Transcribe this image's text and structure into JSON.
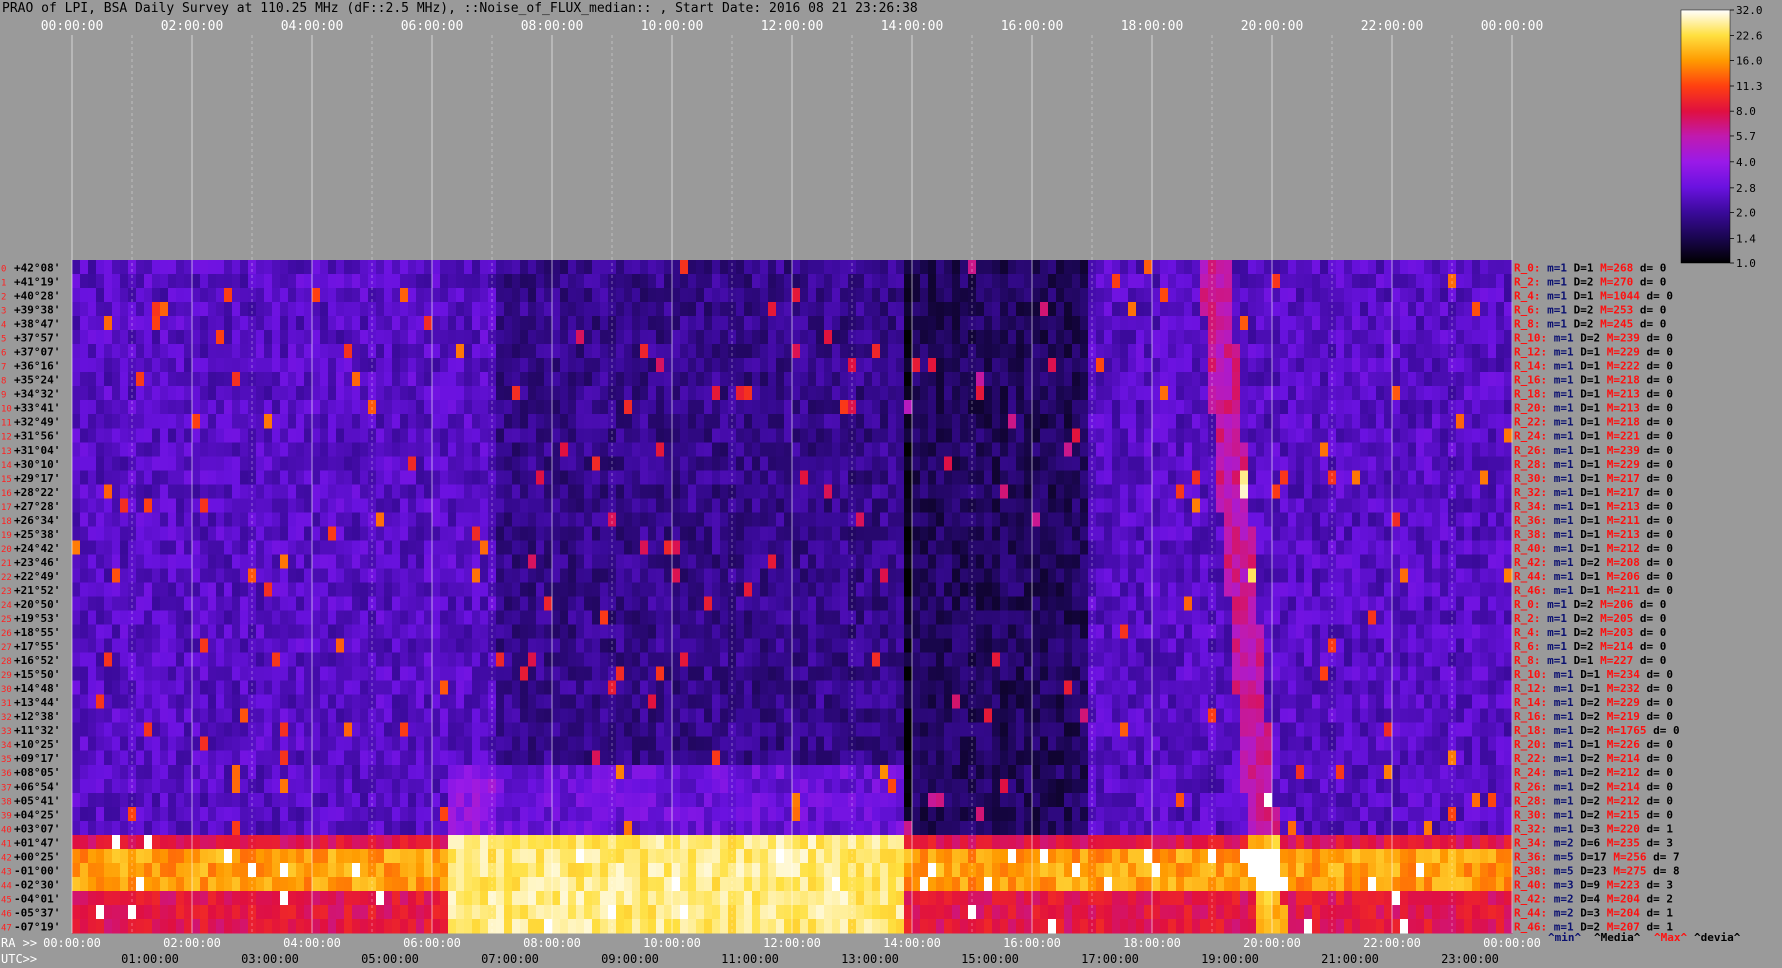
{
  "header": {
    "title": "PRAO of LPI, BSA Daily Survey at 110.25 MHz (dF::2.5 MHz), ::Noise_of_FLUX_median:: , Start Date: 2016 08 21 23:26:38"
  },
  "chart_data": {
    "type": "heatmap",
    "title": "PRAO of LPI, BSA Daily Survey at 110.25 MHz (dF::2.5 MHz), ::Noise_of_FLUX_median:: , Start Date: 2016 08 21 23:26:38",
    "x_top_ticks": [
      "00:00:00",
      "02:00:00",
      "04:00:00",
      "06:00:00",
      "08:00:00",
      "10:00:00",
      "12:00:00",
      "14:00:00",
      "16:00:00",
      "18:00:00",
      "20:00:00",
      "22:00:00",
      "00:00:00"
    ],
    "x_bottom_ra_ticks": [
      "00:00:00",
      "02:00:00",
      "04:00:00",
      "06:00:00",
      "08:00:00",
      "10:00:00",
      "12:00:00",
      "14:00:00",
      "16:00:00",
      "18:00:00",
      "20:00:00",
      "22:00:00",
      "00:00:00"
    ],
    "x_bottom_utc_ticks": [
      "01:00:00",
      "03:00:00",
      "05:00:00",
      "07:00:00",
      "09:00:00",
      "11:00:00",
      "13:00:00",
      "15:00:00",
      "17:00:00",
      "19:00:00",
      "21:00:00",
      "23:00:00"
    ],
    "ra_label": "RA >>",
    "utc_label": "UTC>>",
    "declinations": [
      "+42°08'",
      "+41°19'",
      "+40°28'",
      "+39°38'",
      "+38°47'",
      "+37°57'",
      "+37°07'",
      "+36°16'",
      "+35°24'",
      "+34°32'",
      "+33°41'",
      "+32°49'",
      "+31°56'",
      "+31°04'",
      "+30°10'",
      "+29°17'",
      "+28°22'",
      "+27°28'",
      "+26°34'",
      "+25°38'",
      "+24°42'",
      "+23°46'",
      "+22°49'",
      "+21°52'",
      "+20°50'",
      "+19°53'",
      "+18°55'",
      "+17°55'",
      "+16°52'",
      "+15°50'",
      "+14°48'",
      "+13°44'",
      "+12°38'",
      "+11°32'",
      "+10°25'",
      "+09°17'",
      "+08°05'",
      "+06°54'",
      "+05°41'",
      "+04°25'",
      "+03°07'",
      "+01°47'",
      "+00°25'",
      "-01°00'",
      "-02°30'",
      "-04°01'",
      "-05°37'",
      "-07°19'"
    ],
    "row_indices": [
      "0",
      "1",
      "2",
      "3",
      "4",
      "5",
      "6",
      "7",
      "8",
      "9",
      "10",
      "11",
      "12",
      "13",
      "14",
      "15",
      "16",
      "17",
      "18",
      "19",
      "20",
      "21",
      "22",
      "23",
      "24",
      "25",
      "26",
      "27",
      "28",
      "29",
      "30",
      "31",
      "32",
      "33",
      "34",
      "35",
      "36",
      "37",
      "38",
      "39",
      "40",
      "41",
      "42",
      "43",
      "44",
      "45",
      "46",
      "47"
    ],
    "stats": [
      {
        "r": "R_0:",
        "m": "m=1",
        "D": "D=1",
        "M": "M=268",
        "d": "d= 0"
      },
      {
        "r": "R_2:",
        "m": "m=1",
        "D": "D=2",
        "M": "M=270",
        "d": "d= 0"
      },
      {
        "r": "R_4:",
        "m": "m=1",
        "D": "D=1",
        "M": "M=1044",
        "d": "d= 0"
      },
      {
        "r": "R_6:",
        "m": "m=1",
        "D": "D=2",
        "M": "M=253",
        "d": "d= 0"
      },
      {
        "r": "R_8:",
        "m": "m=1",
        "D": "D=2",
        "M": "M=245",
        "d": "d= 0"
      },
      {
        "r": "R_10:",
        "m": "m=1",
        "D": "D=2",
        "M": "M=239",
        "d": "d= 0"
      },
      {
        "r": "R_12:",
        "m": "m=1",
        "D": "D=1",
        "M": "M=229",
        "d": "d= 0"
      },
      {
        "r": "R_14:",
        "m": "m=1",
        "D": "D=1",
        "M": "M=222",
        "d": "d= 0"
      },
      {
        "r": "R_16:",
        "m": "m=1",
        "D": "D=1",
        "M": "M=218",
        "d": "d= 0"
      },
      {
        "r": "R_18:",
        "m": "m=1",
        "D": "D=1",
        "M": "M=213",
        "d": "d= 0"
      },
      {
        "r": "R_20:",
        "m": "m=1",
        "D": "D=1",
        "M": "M=213",
        "d": "d= 0"
      },
      {
        "r": "R_22:",
        "m": "m=1",
        "D": "D=1",
        "M": "M=218",
        "d": "d= 0"
      },
      {
        "r": "R_24:",
        "m": "m=1",
        "D": "D=1",
        "M": "M=221",
        "d": "d= 0"
      },
      {
        "r": "R_26:",
        "m": "m=1",
        "D": "D=1",
        "M": "M=239",
        "d": "d= 0"
      },
      {
        "r": "R_28:",
        "m": "m=1",
        "D": "D=1",
        "M": "M=229",
        "d": "d= 0"
      },
      {
        "r": "R_30:",
        "m": "m=1",
        "D": "D=1",
        "M": "M=217",
        "d": "d= 0"
      },
      {
        "r": "R_32:",
        "m": "m=1",
        "D": "D=1",
        "M": "M=217",
        "d": "d= 0"
      },
      {
        "r": "R_34:",
        "m": "m=1",
        "D": "D=1",
        "M": "M=213",
        "d": "d= 0"
      },
      {
        "r": "R_36:",
        "m": "m=1",
        "D": "D=1",
        "M": "M=211",
        "d": "d= 0"
      },
      {
        "r": "R_38:",
        "m": "m=1",
        "D": "D=1",
        "M": "M=213",
        "d": "d= 0"
      },
      {
        "r": "R_40:",
        "m": "m=1",
        "D": "D=1",
        "M": "M=212",
        "d": "d= 0"
      },
      {
        "r": "R_42:",
        "m": "m=1",
        "D": "D=2",
        "M": "M=208",
        "d": "d= 0"
      },
      {
        "r": "R_44:",
        "m": "m=1",
        "D": "D=1",
        "M": "M=206",
        "d": "d= 0"
      },
      {
        "r": "R_46:",
        "m": "m=1",
        "D": "D=1",
        "M": "M=211",
        "d": "d= 0"
      },
      {
        "r": "R_0:",
        "m": "m=1",
        "D": "D=2",
        "M": "M=206",
        "d": "d= 0"
      },
      {
        "r": "R_2:",
        "m": "m=1",
        "D": "D=2",
        "M": "M=205",
        "d": "d= 0"
      },
      {
        "r": "R_4:",
        "m": "m=1",
        "D": "D=2",
        "M": "M=203",
        "d": "d= 0"
      },
      {
        "r": "R_6:",
        "m": "m=1",
        "D": "D=2",
        "M": "M=214",
        "d": "d= 0"
      },
      {
        "r": "R_8:",
        "m": "m=1",
        "D": "D=1",
        "M": "M=227",
        "d": "d= 0"
      },
      {
        "r": "R_10:",
        "m": "m=1",
        "D": "D=1",
        "M": "M=234",
        "d": "d= 0"
      },
      {
        "r": "R_12:",
        "m": "m=1",
        "D": "D=1",
        "M": "M=232",
        "d": "d= 0"
      },
      {
        "r": "R_14:",
        "m": "m=1",
        "D": "D=2",
        "M": "M=229",
        "d": "d= 0"
      },
      {
        "r": "R_16:",
        "m": "m=1",
        "D": "D=2",
        "M": "M=219",
        "d": "d= 0"
      },
      {
        "r": "R_18:",
        "m": "m=1",
        "D": "D=2",
        "M": "M=1765",
        "d": "d= 0"
      },
      {
        "r": "R_20:",
        "m": "m=1",
        "D": "D=1",
        "M": "M=226",
        "d": "d= 0"
      },
      {
        "r": "R_22:",
        "m": "m=1",
        "D": "D=2",
        "M": "M=214",
        "d": "d= 0"
      },
      {
        "r": "R_24:",
        "m": "m=1",
        "D": "D=2",
        "M": "M=212",
        "d": "d= 0"
      },
      {
        "r": "R_26:",
        "m": "m=1",
        "D": "D=2",
        "M": "M=214",
        "d": "d= 0"
      },
      {
        "r": "R_28:",
        "m": "m=1",
        "D": "D=2",
        "M": "M=212",
        "d": "d= 0"
      },
      {
        "r": "R_30:",
        "m": "m=1",
        "D": "D=2",
        "M": "M=215",
        "d": "d= 0"
      },
      {
        "r": "R_32:",
        "m": "m=1",
        "D": "D=3",
        "M": "M=220",
        "d": "d= 1"
      },
      {
        "r": "R_34:",
        "m": "m=2",
        "D": "D=6",
        "M": "M=235",
        "d": "d= 3"
      },
      {
        "r": "R_36:",
        "m": "m=5",
        "D": "D=17",
        "M": "M=256",
        "d": "d= 7"
      },
      {
        "r": "R_38:",
        "m": "m=5",
        "D": "D=23",
        "M": "M=275",
        "d": "d= 8"
      },
      {
        "r": "R_40:",
        "m": "m=3",
        "D": "D=9",
        "M": "M=223",
        "d": "d= 3"
      },
      {
        "r": "R_42:",
        "m": "m=2",
        "D": "D=4",
        "M": "M=204",
        "d": "d= 2"
      },
      {
        "r": "R_44:",
        "m": "m=2",
        "D": "D=3",
        "M": "M=204",
        "d": "d= 1"
      },
      {
        "r": "R_46:",
        "m": "m=1",
        "D": "D=2",
        "M": "M=207",
        "d": "d= 1"
      }
    ],
    "stats_legend": [
      "^min^",
      "^Media^",
      "^Max^",
      "^devia^"
    ],
    "colorbar_ticks": [
      "32.0",
      "22.6",
      "16.0",
      "11.3",
      "8.0",
      "5.7",
      "4.0",
      "2.8",
      "2.0",
      "1.4",
      "1.0"
    ],
    "colorbar_range": [
      1.0,
      32.0
    ],
    "colorbar_scale": "log",
    "x_range_hours": [
      0,
      24
    ],
    "colors": {
      "background": "#9a9a9a",
      "stat_red": "#ff1010",
      "stat_blue": "#0a1070",
      "stat_black": "#000000",
      "declination_text": "#000000",
      "row_index_text": "#ff2020"
    }
  }
}
